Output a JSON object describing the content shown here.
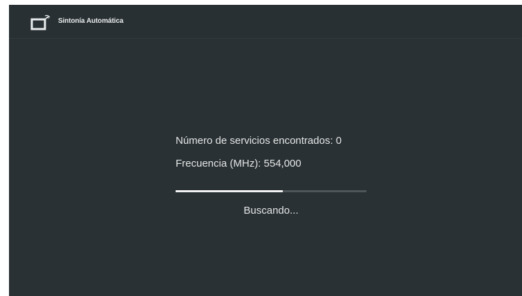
{
  "window": {
    "title": "Sintonía Automática",
    "icon": "tv-signal-icon"
  },
  "scan": {
    "services_text": "Número de servicios encontrados: 0",
    "frequency_text": "Frecuencia (MHz): 554,000",
    "progress_percent": 56,
    "status": "Buscando..."
  },
  "colors": {
    "background": "#2a3134",
    "titlebar": "#283033",
    "text": "#e3e6e6",
    "progress_fill": "#f2f2f2",
    "progress_track": "#4e5659"
  }
}
